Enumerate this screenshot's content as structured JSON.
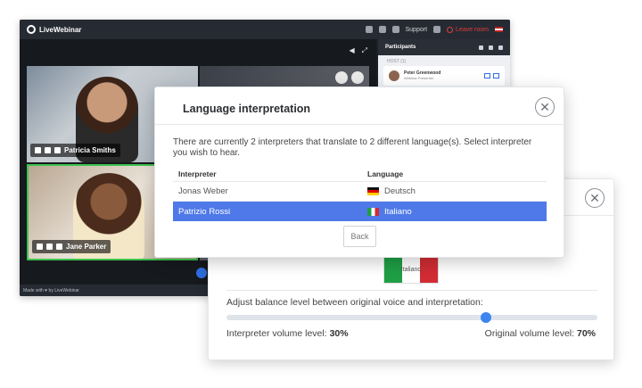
{
  "app": {
    "brand": "LiveWebinar",
    "support_label": "Support",
    "leave_label": "Leave room",
    "footer": "Made with ♥ by LiveWebinar"
  },
  "participants": {
    "title": "Participants",
    "host_label": "HOST (1)",
    "rows": [
      {
        "name": "Peter Greenwood",
        "role": "Webinar Presenter"
      }
    ]
  },
  "video_tiles": [
    {
      "name": "Patricia Smiths"
    },
    {
      "name": "Jane Parker"
    }
  ],
  "dialog": {
    "title": "Language interpretation",
    "description": "There are currently 2 interpreters that translate to 2 different language(s). Select interpreter you wish to hear.",
    "columns": [
      "Interpreter",
      "Language"
    ],
    "rows": [
      {
        "interpreter": "Jonas Weber",
        "language": "Deutsch",
        "flag": "flag-de-icon",
        "selected": false
      },
      {
        "interpreter": "Patrizio Rossi",
        "language": "Italiano",
        "flag": "flag-it-icon",
        "selected": true
      }
    ],
    "back_label": "Back",
    "selected_color": "#4f79e9"
  },
  "balance_dialog": {
    "language_label": "Italiano",
    "balance_label": "Adjust balance level between original voice and interpretation:",
    "interpreter_label": "Interpreter volume level:",
    "interpreter_value": "30%",
    "original_label": "Original volume level:",
    "original_value": "70%",
    "slider_position": 0.7,
    "accent": "#3d85f0"
  }
}
